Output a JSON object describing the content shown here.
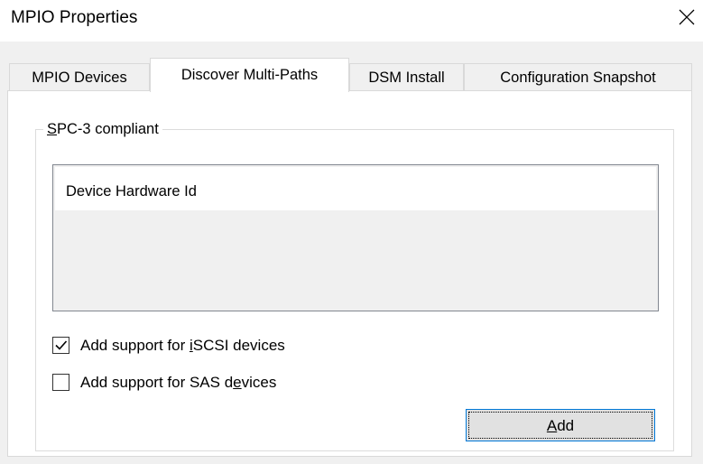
{
  "window": {
    "title": "MPIO Properties",
    "close_glyph": "close-icon"
  },
  "tabs": [
    {
      "label": "MPIO Devices",
      "active": false
    },
    {
      "label": "Discover Multi-Paths",
      "active": true
    },
    {
      "label": "DSM Install",
      "active": false
    },
    {
      "label": "Configuration Snapshot",
      "active": false
    }
  ],
  "group": {
    "legend_mnemonic": "S",
    "legend_rest": "PC-3 compliant"
  },
  "device_list": {
    "items": [
      "Device Hardware Id"
    ]
  },
  "checkboxes": [
    {
      "pre": "Add support for ",
      "mnemonic": "i",
      "post": "SCSI devices",
      "checked": true
    },
    {
      "pre": "Add support for SAS d",
      "mnemonic": "e",
      "post": "vices",
      "checked": false
    }
  ],
  "add_button": {
    "mnemonic": "A",
    "rest": "dd"
  },
  "colors": {
    "accent": "#0078d7",
    "panel": "#ffffff",
    "dialog": "#f0f0f0"
  }
}
